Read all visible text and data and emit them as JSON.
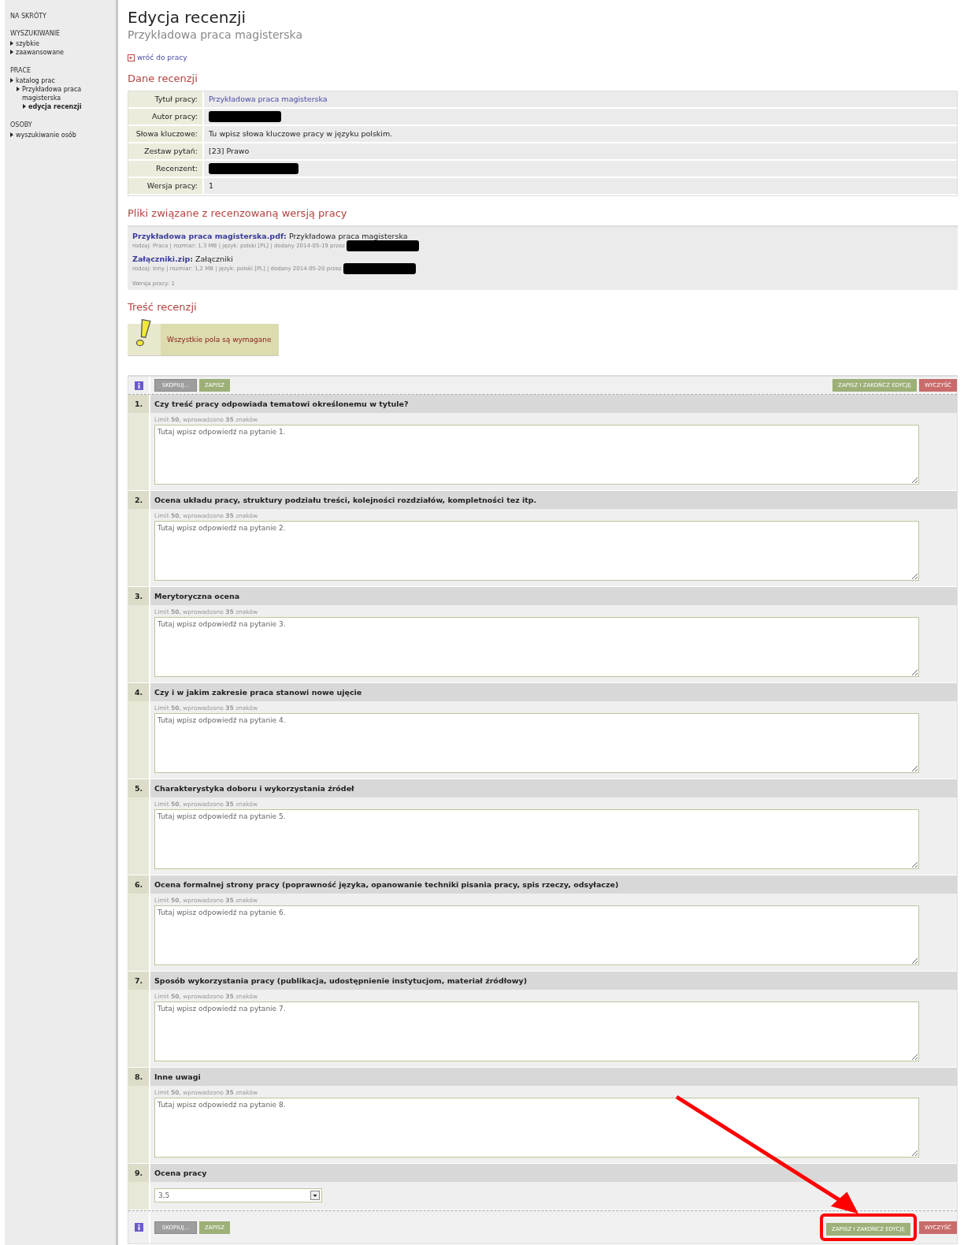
{
  "sidebar": {
    "sections": [
      {
        "title": "NA SKRÓTY"
      },
      {
        "title": "WYSZUKIWANIE",
        "items": [
          {
            "label": "szybkie",
            "selected": false
          },
          {
            "label": "zaawansowane",
            "selected": false
          }
        ]
      },
      {
        "title": "PRACE",
        "items": [
          {
            "label": "katalog prac",
            "selected": false,
            "children": [
              {
                "label": "Przykładowa praca magisterska",
                "selected": false,
                "children": [
                  {
                    "label": "edycja recenzji",
                    "selected": true
                  }
                ]
              }
            ]
          }
        ]
      },
      {
        "title": "OSOBY",
        "items": [
          {
            "label": "wyszukiwanie osób",
            "selected": false
          }
        ]
      }
    ]
  },
  "header": {
    "title": "Edycja recenzji",
    "subtitle": "Przykładowa praca magisterska",
    "back_link": "wróć do pracy"
  },
  "review_data": {
    "heading": "Dane recenzji",
    "rows": [
      {
        "label": "Tytuł pracy:",
        "kind": "link",
        "value": "Przykładowa praca magisterska"
      },
      {
        "label": "Autor pracy:",
        "kind": "redacted"
      },
      {
        "label": "Słowa kluczowe:",
        "kind": "text",
        "value": "Tu wpisz słowa kluczowe pracy w języku polskim."
      },
      {
        "label": "Zestaw pytań:",
        "kind": "text",
        "value": "[23] Prawo"
      },
      {
        "label": "Recenzent:",
        "kind": "redacted"
      },
      {
        "label": "Wersja pracy:",
        "kind": "text",
        "value": "1"
      }
    ]
  },
  "files": {
    "heading": "Pliki związane z recenzowaną wersją pracy",
    "items": [
      {
        "name": "Przykładowa praca magisterska.pdf:",
        "description": "Przykładowa praca magisterska",
        "meta": "rodzaj: Praca | rozmiar: 1,3 MB | język: polski [PL] | dodany 2014-05-19 przez",
        "author_redacted": true
      },
      {
        "name": "Załączniki.zip:",
        "description": "Załączniki",
        "meta": "rodzaj: Inny | rozmiar: 1,2 MB | język: polski [PL] | dodany 2014-05-20 przez",
        "author_redacted": true
      }
    ],
    "version_note": "Wersja pracy: 1"
  },
  "content": {
    "heading": "Treść recenzji",
    "warning": "Wszystkie pola są wymagane"
  },
  "toolbars": [
    {
      "highlighted": false,
      "left_buttons": [
        {
          "label": "SKOPIUJ...",
          "kind": "disabled"
        },
        {
          "label": "ZAPISZ",
          "kind": "save"
        }
      ],
      "right_buttons": [
        {
          "label": "ZAPISZ I ZAKOŃCZ EDYCJĘ",
          "kind": "save"
        },
        {
          "label": "WYCZYŚĆ",
          "kind": "clear"
        }
      ]
    },
    {
      "highlighted": true,
      "left_buttons": [
        {
          "label": "SKOPIUJ...",
          "kind": "disabled"
        },
        {
          "label": "ZAPISZ",
          "kind": "save"
        }
      ],
      "right_buttons": [
        {
          "label": "ZAPISZ I ZAKOŃCZ EDYCJĘ",
          "kind": "save"
        },
        {
          "label": "WYCZYŚĆ",
          "kind": "clear"
        }
      ]
    }
  ],
  "questions": [
    {
      "number": "1.",
      "kind": "text",
      "title": "Czy treść pracy odpowiada tematowi określonemu w tytule?",
      "counter": "Limit **50**, wprowadzono **35** znaków",
      "answer": "Tutaj wpisz odpowiedź na pytanie 1."
    },
    {
      "number": "2.",
      "kind": "text",
      "title": "Ocena układu pracy, struktury podziału treści, kolejności rozdziałów, kompletności tez itp.",
      "counter": "Limit **50**, wprowadzono **35** znaków",
      "answer": "Tutaj wpisz odpowiedź na pytanie 2."
    },
    {
      "number": "3.",
      "kind": "text",
      "title": "Merytoryczna ocena",
      "counter": "Limit **50**, wprowadzono **35** znaków",
      "answer": "Tutaj wpisz odpowiedź na pytanie 3."
    },
    {
      "number": "4.",
      "kind": "text",
      "title": "Czy i w jakim zakresie praca stanowi nowe ujęcie",
      "counter": "Limit **50**, wprowadzono **35** znaków",
      "answer": "Tutaj wpisz odpowiedź na pytanie 4."
    },
    {
      "number": "5.",
      "kind": "text",
      "title": "Charakterystyka doboru i wykorzystania źródeł",
      "counter": "Limit **50**, wprowadzono **35** znaków",
      "answer": "Tutaj wpisz odpowiedź na pytanie 5."
    },
    {
      "number": "6.",
      "kind": "text",
      "title": "Ocena formalnej strony pracy (poprawność języka, opanowanie techniki pisania pracy, spis rzeczy, odsyłacze)",
      "counter": "Limit **50**, wprowadzono **35** znaków",
      "answer": "Tutaj wpisz odpowiedź na pytanie 6."
    },
    {
      "number": "7.",
      "kind": "text",
      "title": "Sposób wykorzystania pracy (publikacja, udostępnienie instytucjom, materiał źródłowy)",
      "counter": "Limit **50**, wprowadzono **35** znaków",
      "answer": "Tutaj wpisz odpowiedź na pytanie 7."
    },
    {
      "number": "8.",
      "kind": "text",
      "title": "Inne uwagi",
      "counter": "Limit **50**, wprowadzono **35** znaków",
      "answer": "Tutaj wpisz odpowiedź na pytanie 8."
    },
    {
      "number": "9.",
      "kind": "select",
      "title": "Ocena pracy",
      "answer": "3,5"
    }
  ]
}
